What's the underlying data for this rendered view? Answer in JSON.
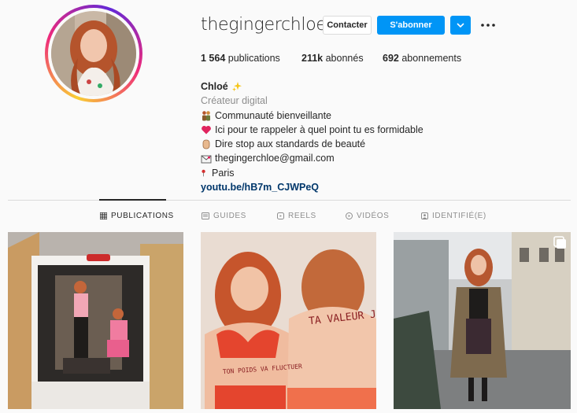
{
  "profile": {
    "username": "thegingerchloe",
    "contact_label": "Contacter",
    "follow_label": "S'abonner"
  },
  "stats": {
    "posts_count": "1 564",
    "posts_label": "publications",
    "followers_count": "211k",
    "followers_label": "abonnés",
    "following_count": "692",
    "following_label": "abonnements"
  },
  "bio": {
    "name": "Chloé",
    "category": "Créateur digital",
    "lines": [
      "Communauté bienveillante",
      "Ici pour te rappeler à quel point tu es formidable",
      "Dire stop aux standards de beauté",
      "thegingerchloe@gmail.com",
      "Paris"
    ],
    "link": "youtu.be/hB7m_CJWPeQ"
  },
  "tabs": [
    {
      "label": "PUBLICATIONS",
      "active": true
    },
    {
      "label": "GUIDES",
      "active": false
    },
    {
      "label": "REELS",
      "active": false
    },
    {
      "label": "VIDÉOS",
      "active": false
    },
    {
      "label": "IDENTIFIÉ(E)",
      "active": false
    }
  ],
  "posts": {
    "post2_text_back": "TA VALEUR JAMAIS",
    "post2_text_belly": "TON POIDS VA FLUCTUER"
  },
  "icons": [
    "more-icon",
    "chevron-down-icon",
    "grid-icon",
    "guides-icon",
    "reels-icon",
    "video-icon",
    "tagged-icon",
    "sparkles-icon",
    "people-icon",
    "heart-icon",
    "hand-icon",
    "envelope-icon",
    "pin-icon",
    "multi-photo-icon"
  ],
  "colors": {
    "accent": "#0095f6",
    "link": "#00376b",
    "muted": "#8e8e8e",
    "heart": "#e0245e"
  }
}
